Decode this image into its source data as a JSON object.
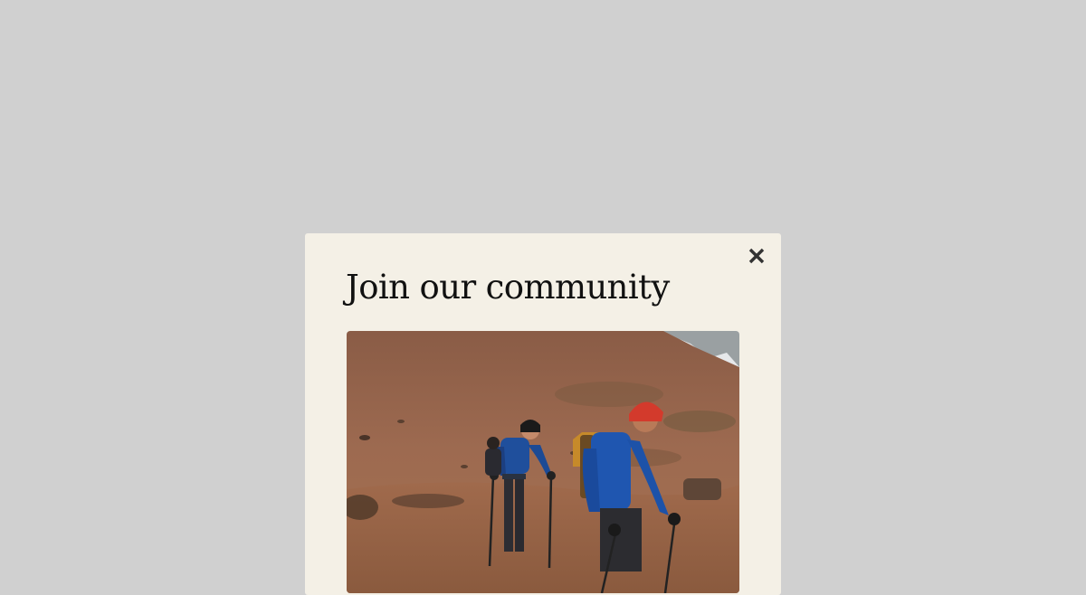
{
  "modal": {
    "title": "Join our community",
    "close_icon": "close-icon",
    "photo": {
      "subject": "hikers-on-mountain-slope"
    }
  },
  "colors": {
    "overlay": "#d0d0d0",
    "modal_background": "#f4f0e6",
    "title_text": "#111111",
    "close_icon": "#333333"
  }
}
